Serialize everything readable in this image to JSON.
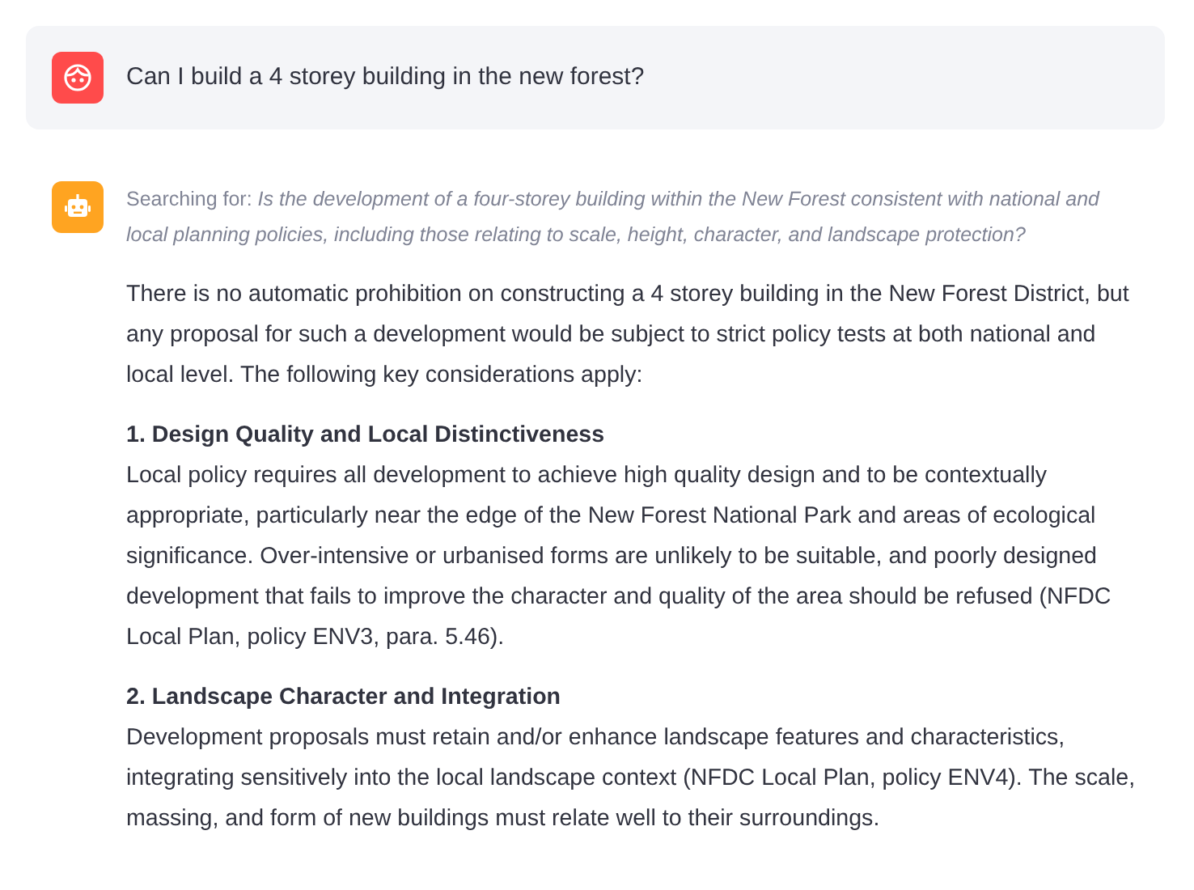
{
  "messages": [
    {
      "kind": "user",
      "text": "Can I build a 4 storey building in the new forest?"
    },
    {
      "kind": "assistant",
      "search": "Searching for: *Is the development of a four-storey building within the New Forest consistent with national and local planning policies, including those relating to scale, height, character, and landscape protection?*",
      "intro": "There is no automatic prohibition on constructing a 4 storey building in the New Forest District, but any proposal for such a development would be subject to strict policy tests at both national and local level. The following key considerations apply:",
      "sections": [
        {
          "heading": "1. Design Quality and Local Distinctiveness",
          "text": "Local policy requires all development to achieve high quality design and to be contextually appropriate, particularly near the edge of the New Forest National Park and areas of ecological significance. Over-intensive or urbanised forms are unlikely to be suitable, and poorly designed development that fails to improve the character and quality of the area should be refused (NFDC Local Plan, policy ENV3, para. 5.46)."
        },
        {
          "heading": "2. Landscape Character and Integration",
          "text": "Development proposals must retain and/or enhance landscape features and characteristics, integrating sensitively into the local landscape context (NFDC Local Plan, policy ENV4). The scale, massing, and form of new buildings must relate well to their surroundings."
        }
      ]
    }
  ]
}
